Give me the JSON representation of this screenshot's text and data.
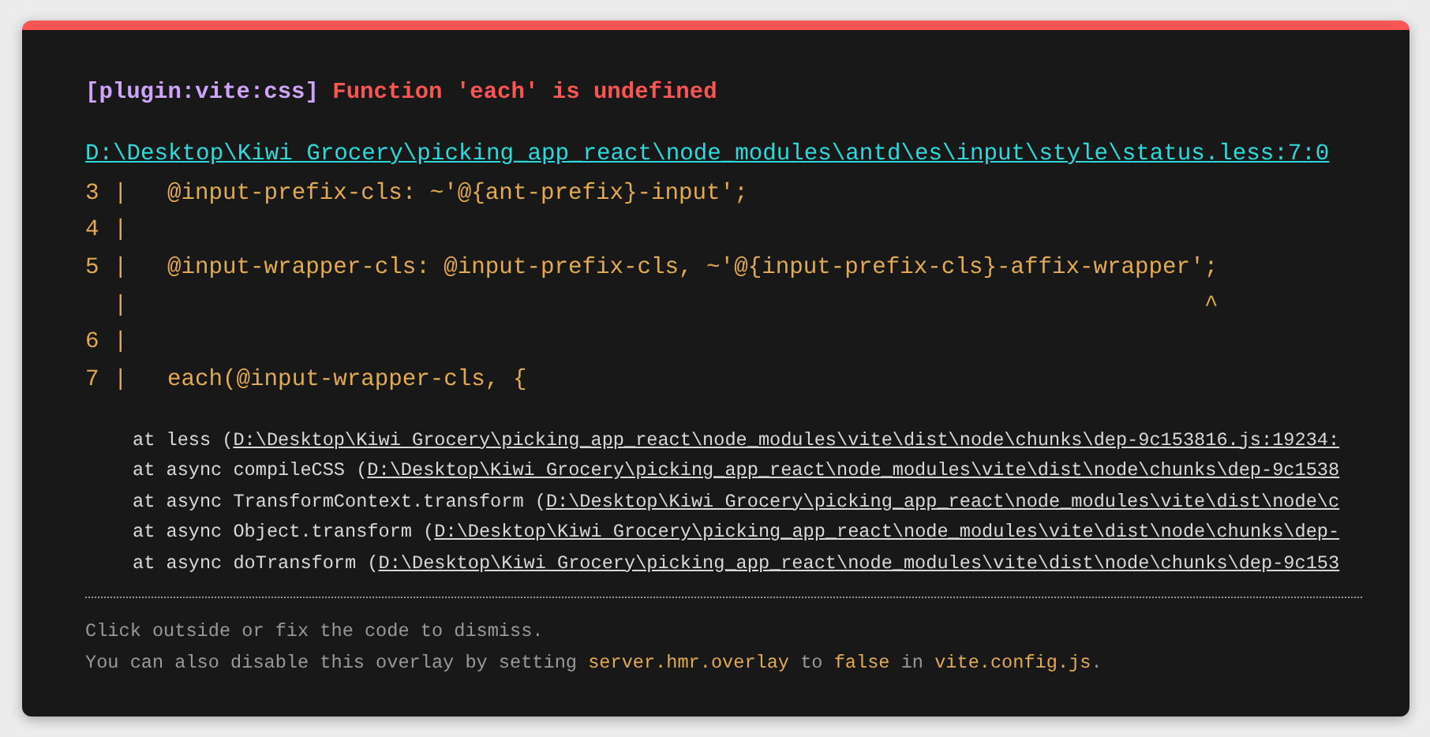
{
  "plugin": "[plugin:vite:css]",
  "message": "Function 'each' is undefined",
  "file_link": "D:\\Desktop\\Kiwi Grocery\\picking_app_react\\node_modules\\antd\\es\\input\\style\\status.less:7:0",
  "code_frame": [
    {
      "line_number": "3",
      "bar": "|",
      "code": "@input-prefix-cls: ~'@{ant-prefix}-input';"
    },
    {
      "line_number": "4",
      "bar": "|"
    },
    {
      "line_number": "5",
      "bar": "|",
      "code": "@input-wrapper-cls: @input-prefix-cls, ~'@{input-prefix-cls}-affix-wrapper';"
    },
    {
      "bar": "|",
      "caret": "^"
    },
    {
      "line_number": "6",
      "bar": "|"
    },
    {
      "line_number": "7",
      "bar": "|",
      "code": "each(@input-wrapper-cls, {"
    }
  ],
  "stack": [
    {
      "prefix": "at less (",
      "path": "D:\\Desktop\\Kiwi Grocery\\picking_app_react\\node_modules\\vite\\dist\\node\\chunks\\dep-9c153816.js:19234:"
    },
    {
      "prefix": "at async compileCSS (",
      "path": "D:\\Desktop\\Kiwi Grocery\\picking_app_react\\node_modules\\vite\\dist\\node\\chunks\\dep-9c1538"
    },
    {
      "prefix": "at async TransformContext.transform (",
      "path": "D:\\Desktop\\Kiwi Grocery\\picking_app_react\\node_modules\\vite\\dist\\node\\c"
    },
    {
      "prefix": "at async Object.transform (",
      "path": "D:\\Desktop\\Kiwi Grocery\\picking_app_react\\node_modules\\vite\\dist\\node\\chunks\\dep-"
    },
    {
      "prefix": "at async doTransform (",
      "path": "D:\\Desktop\\Kiwi Grocery\\picking_app_react\\node_modules\\vite\\dist\\node\\chunks\\dep-9c153"
    }
  ],
  "tips": [
    [
      {
        "kind": "plain",
        "text": "Click outside or fix the code to dismiss."
      }
    ],
    [
      {
        "kind": "plain",
        "text": "You can also disable this overlay by setting "
      },
      {
        "kind": "code",
        "text": "server.hmr.overlay"
      },
      {
        "kind": "plain",
        "text": " to "
      },
      {
        "kind": "code",
        "text": "false"
      },
      {
        "kind": "plain",
        "text": " in "
      },
      {
        "kind": "code",
        "text": "vite.config.js"
      },
      {
        "kind": "plain",
        "text": "."
      }
    ]
  ]
}
